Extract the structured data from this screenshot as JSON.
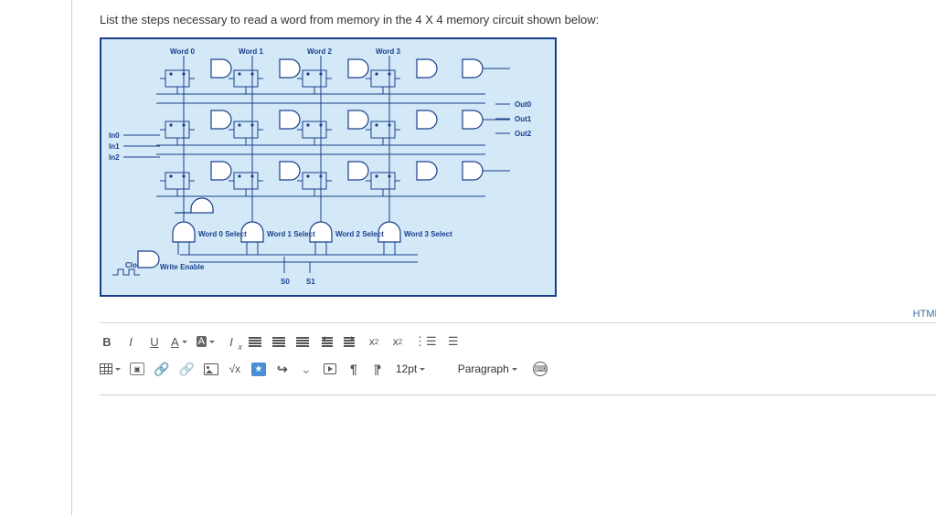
{
  "question": "List the steps necessary to read a word from memory in the 4 X 4 memory circuit shown below:",
  "diagram": {
    "word_labels": [
      "Word 0",
      "Word 1",
      "Word 2",
      "Word 3"
    ],
    "select_labels": [
      "Word 0 Select",
      "Word 1 Select",
      "Word 2 Select",
      "Word 3 Select"
    ],
    "in_labels": [
      "In0",
      "In1",
      "In2"
    ],
    "out_labels": [
      "Out0",
      "Out1",
      "Out2"
    ],
    "s_labels": [
      "S0",
      "S1"
    ],
    "clock": "Clock",
    "write_enable": "Write Enable"
  },
  "html_editor": "HTML Editor",
  "toolbar": {
    "row1": {
      "bold": "B",
      "italic": "I",
      "underline": "U",
      "fontcolor": "A",
      "highlight": "A",
      "clear": "x",
      "sup": "x",
      "sub": "x"
    },
    "row2": {
      "sqrt": "√x",
      "arrows": "↕",
      "font_size": "12pt",
      "paragraph": "Paragraph"
    }
  }
}
